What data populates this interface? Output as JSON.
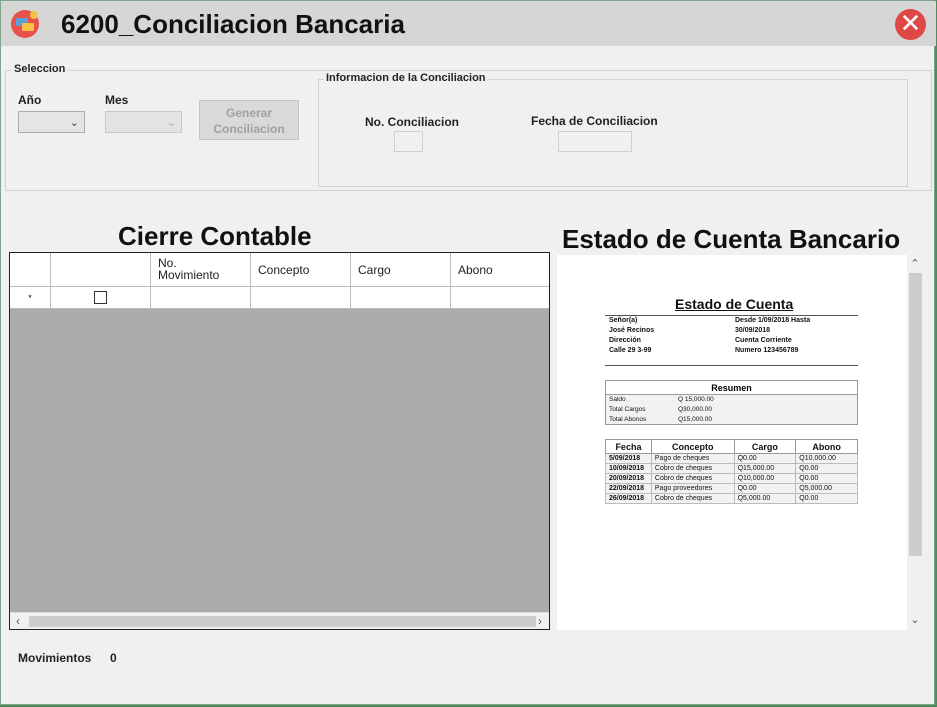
{
  "window": {
    "title": "6200_Conciliacion Bancaria",
    "close_glyph": "✕"
  },
  "seleccion": {
    "group_label": "Seleccion",
    "year_label": "Año",
    "month_label": "Mes",
    "year_value": "",
    "month_value": "",
    "generate_button": "Generar Conciliacion"
  },
  "info": {
    "group_label": "Informacion de la Conciliacion",
    "number_label": "No. Conciliacion",
    "date_label": "Fecha de Conciliacion",
    "number_value": "",
    "date_value": ""
  },
  "cierre": {
    "title": "Cierre Contable",
    "columns": [
      "",
      "",
      "No.\nMovimiento",
      "Concepto",
      "Cargo",
      "Abono"
    ],
    "new_row_marker": "*"
  },
  "estado": {
    "title": "Estado de Cuenta Bancario",
    "document": {
      "heading": "Estado de Cuenta",
      "left_lines": [
        "Señor(a)",
        "José Recinos",
        "Dirección",
        "Calle 29 3-99"
      ],
      "right_lines": [
        "Desde 1/09/2018  Hasta",
        "30/09/2018",
        "Cuenta Corriente",
        "Numero 123456789"
      ],
      "summary_title": "Resumen",
      "summary_rows": [
        {
          "label": "Saldo",
          "value": "Q 15,000.00"
        },
        {
          "label": "Total Cargos",
          "value": "Q30,000.00"
        },
        {
          "label": "Total Abonos",
          "value": "Q15,000.00"
        }
      ],
      "movement_headers": [
        "Fecha",
        "Concepto",
        "Cargo",
        "Abono"
      ],
      "movements": [
        {
          "fecha": "5/09/2018",
          "concepto": "Pago de cheques",
          "cargo": "Q0.00",
          "abono": "Q10,000.00"
        },
        {
          "fecha": "10/09/2018",
          "concepto": "Cobro de cheques",
          "cargo": "Q15,000.00",
          "abono": "Q0.00"
        },
        {
          "fecha": "20/09/2018",
          "concepto": "Cobro de cheques",
          "cargo": "Q10,000.00",
          "abono": "Q0.00"
        },
        {
          "fecha": "22/09/2018",
          "concepto": "Pago proveedores",
          "cargo": "Q0.00",
          "abono": "Q5,000.00"
        },
        {
          "fecha": "26/09/2018",
          "concepto": "Cobro de cheques",
          "cargo": "Q5,000.00",
          "abono": "Q0.00"
        }
      ]
    }
  },
  "status": {
    "movements_label": "Movimientos",
    "movements_count": "0"
  },
  "colors": {
    "close_button": "#e04848",
    "grid_empty_area": "#ababab",
    "window_background": "#f0f0f0"
  }
}
